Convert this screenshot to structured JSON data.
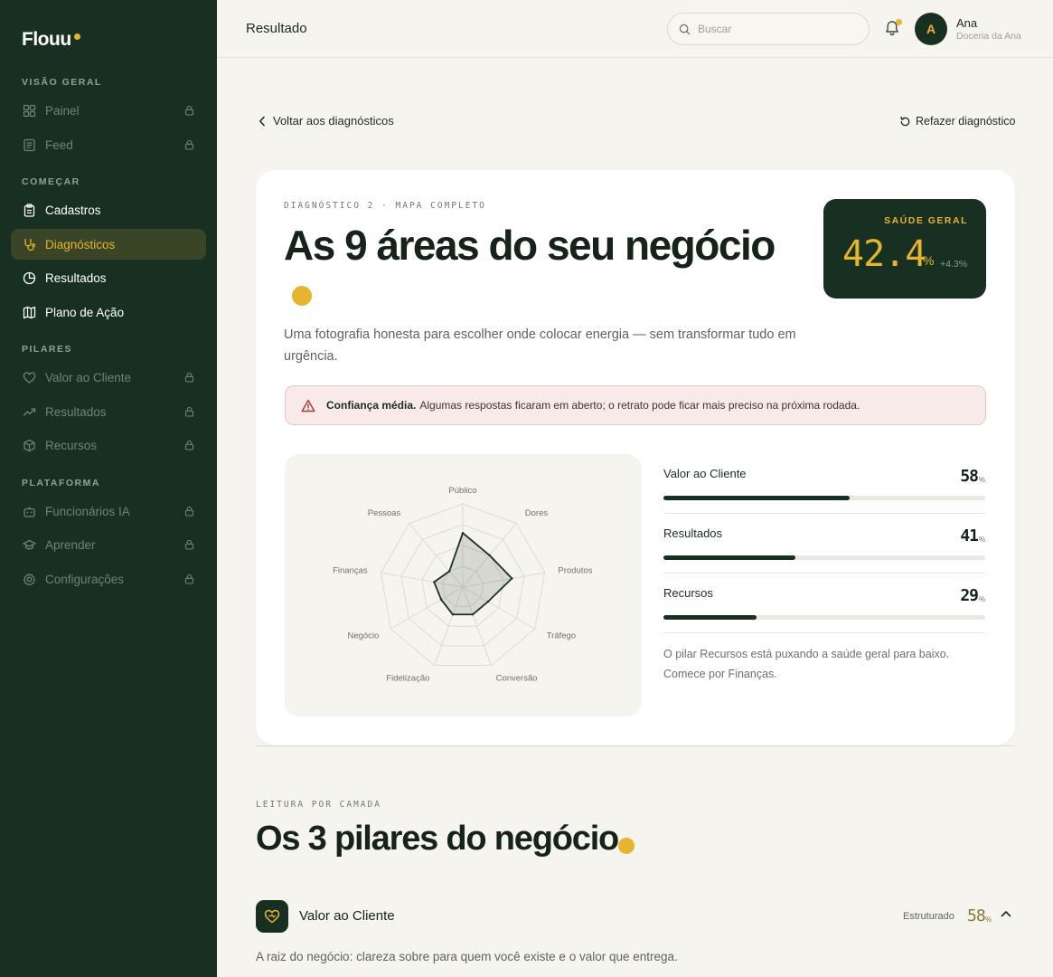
{
  "brand": {
    "name": "Flouu"
  },
  "sidebar": {
    "sections": [
      {
        "label": "VISÃO GERAL",
        "items": [
          {
            "label": "Painel",
            "icon": "grid-icon",
            "state": "locked"
          },
          {
            "label": "Feed",
            "icon": "newspaper-icon",
            "state": "locked"
          }
        ]
      },
      {
        "label": "COMEÇAR",
        "items": [
          {
            "label": "Cadastros",
            "icon": "clipboard-icon",
            "state": "enabled"
          },
          {
            "label": "Diagnósticos",
            "icon": "stethoscope-icon",
            "state": "active"
          },
          {
            "label": "Resultados",
            "icon": "pie-chart-icon",
            "state": "enabled"
          },
          {
            "label": "Plano de Ação",
            "icon": "map-icon",
            "state": "enabled"
          }
        ]
      },
      {
        "label": "PILARES",
        "items": [
          {
            "label": "Valor ao Cliente",
            "icon": "heart-icon",
            "state": "locked"
          },
          {
            "label": "Resultados",
            "icon": "trending-up-icon",
            "state": "locked"
          },
          {
            "label": "Recursos",
            "icon": "box-icon",
            "state": "locked"
          }
        ]
      },
      {
        "label": "PLATAFORMA",
        "items": [
          {
            "label": "Funcionários IA",
            "icon": "bot-icon",
            "state": "locked"
          },
          {
            "label": "Aprender",
            "icon": "graduation-cap-icon",
            "state": "locked"
          },
          {
            "label": "Configurações",
            "icon": "gear-icon",
            "state": "locked"
          }
        ]
      }
    ]
  },
  "topbar": {
    "title": "Resultado",
    "search_placeholder": "Buscar",
    "user": {
      "initial": "A",
      "name": "Ana",
      "company": "Doceria da Ana"
    }
  },
  "content": {
    "back_label": "Voltar aos diagnósticos",
    "redo_label": "Refazer diagnóstico",
    "card": {
      "eyebrow": "DIAGNÓSTICO 2 · MAPA COMPLETO",
      "title": "As 9 áreas do seu negócio",
      "description": "Uma fotografia honesta para escolher onde colocar energia — sem transformar tudo em urgência.",
      "health": {
        "label": "SAÚDE GERAL",
        "value": "42.4",
        "unit": "%",
        "delta": "+4.3%"
      },
      "alert": {
        "strong": "Confiança média.",
        "text": "Algumas respostas ficaram em aberto; o retrato pode ficar mais preciso na próxima rodada."
      },
      "pillars": [
        {
          "name": "Valor ao Cliente",
          "value": 58,
          "unit": "%"
        },
        {
          "name": "Resultados",
          "value": 41,
          "unit": "%"
        },
        {
          "name": "Recursos",
          "value": 29,
          "unit": "%"
        }
      ],
      "pillar_note": "O pilar Recursos está puxando a saúde geral para baixo. Comece por Finanças."
    },
    "layers": {
      "eyebrow": "LEITURA POR CAMADA",
      "title": "Os 3 pilares do negócio",
      "accordion": {
        "name": "Valor ao Cliente",
        "status": "Estruturado",
        "value": "58",
        "unit": "%",
        "description": "A raiz do negócio: clareza sobre para quem você existe e o valor que entrega."
      }
    }
  },
  "chart_data": {
    "type": "radar",
    "categories": [
      "Público",
      "Dores",
      "Produtos",
      "Tráfego",
      "Conversão",
      "Fidelização",
      "Negócio",
      "Finanças",
      "Pessoas"
    ],
    "values": [
      65,
      50,
      60,
      35,
      35,
      35,
      30,
      35,
      25
    ],
    "range": [
      0,
      100
    ],
    "rings": 4
  },
  "colors": {
    "sidebar_bg": "#183022",
    "accent": "#e6b42e",
    "background": "#f6f4ee"
  }
}
